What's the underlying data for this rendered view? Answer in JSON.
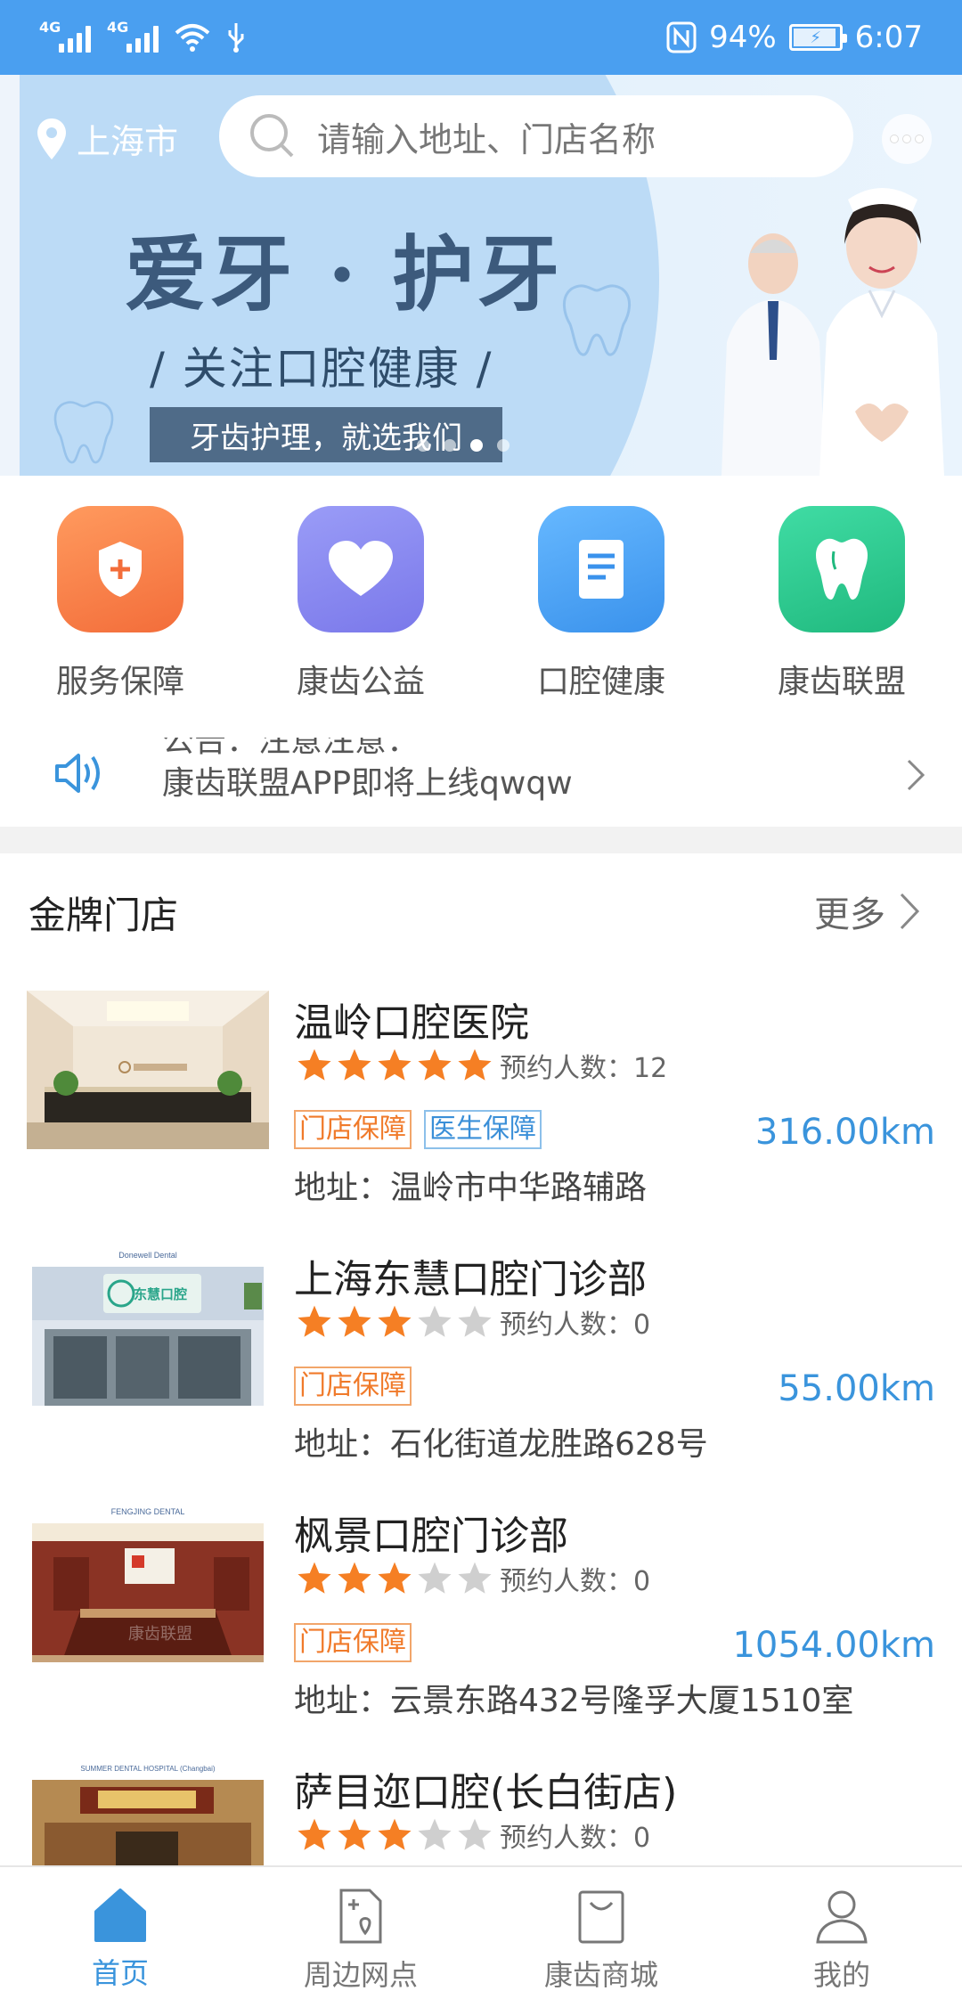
{
  "status_bar": {
    "network_1": "4G",
    "network_2": "4G",
    "battery_level": "94%",
    "time": "6:07"
  },
  "header": {
    "city": "上海市",
    "search_placeholder": "请输入地址、门店名称"
  },
  "banner": {
    "headline": "爱牙 · 护牙",
    "subline": "/ 关注口腔健康 /",
    "tagline": "牙齿护理，就选我们",
    "slide_count": 4,
    "active_slide": 3
  },
  "shortcuts": [
    {
      "label": "服务保障",
      "icon": "shield-plus-icon",
      "color": "#f7804a"
    },
    {
      "label": "康齿公益",
      "icon": "heart-icon",
      "color": "#8a86f2"
    },
    {
      "label": "口腔健康",
      "icon": "document-icon",
      "color": "#4a9ff0"
    },
    {
      "label": "康齿联盟",
      "icon": "tooth-icon",
      "color": "#2ec990"
    }
  ],
  "notice": {
    "line1": "公告：注意注意：",
    "line2": "康齿联盟APP即将上线qwqw"
  },
  "section": {
    "title": "金牌门店",
    "more_label": "更多"
  },
  "stores": [
    {
      "name": "温岭口腔医院",
      "rating": 5,
      "appt_label": "预约人数：12",
      "tags": [
        "门店保障",
        "医生保障"
      ],
      "distance": "316.00km",
      "address": "地址：温岭市中华路辅路"
    },
    {
      "name": "上海东慧口腔门诊部",
      "rating": 3,
      "appt_label": "预约人数：0",
      "tags": [
        "门店保障"
      ],
      "distance": "55.00km",
      "address": "地址：石化街道龙胜路628号",
      "thumb_caption": "Donewell Dental",
      "sign_text": "东慧口腔"
    },
    {
      "name": "枫景口腔门诊部",
      "rating": 3,
      "appt_label": "预约人数：0",
      "tags": [
        "门店保障"
      ],
      "distance": "1054.00km",
      "address": "地址：云景东路432号隆孚大厦1510室",
      "thumb_caption": "FENGJING DENTAL",
      "watermark": "康齿联盟"
    },
    {
      "name": "萨目迩口腔(长白街店)",
      "rating": 3,
      "appt_label": "预约人数：0",
      "tags": [],
      "distance": "",
      "address": "",
      "thumb_caption": "SUMMER DENTAL HOSPITAL (Changbai)"
    }
  ],
  "bottom_nav": [
    {
      "label": "首页",
      "icon": "home-icon",
      "active": true
    },
    {
      "label": "周边网点",
      "icon": "map-pin-document-icon",
      "active": false
    },
    {
      "label": "康齿商城",
      "icon": "shopping-bag-icon",
      "active": false
    },
    {
      "label": "我的",
      "icon": "user-icon",
      "active": false
    }
  ],
  "colors": {
    "primary": "#4a9ff0",
    "orange_tag": "#f07a2a",
    "blue_tag": "#3a8fd8",
    "star": "#f57f24",
    "star_empty": "#cfcfcf"
  }
}
